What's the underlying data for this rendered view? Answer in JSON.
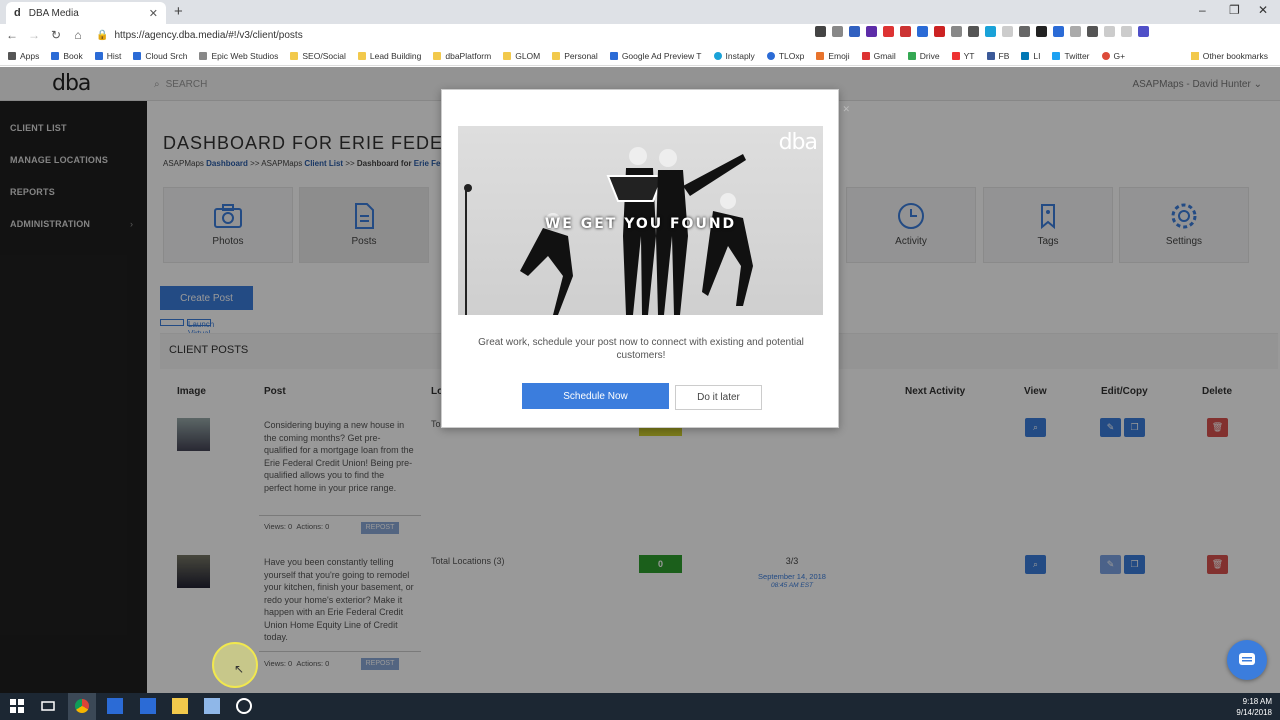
{
  "browser": {
    "tab_title": "DBA Media",
    "url": "https://agency.dba.media/#!/v3/client/posts",
    "bookmarks": [
      "Apps",
      "Book",
      "Hist",
      "Cloud Srch",
      "Epic Web Studios",
      "SEO/Social",
      "Lead Building",
      "dbaPlatform",
      "GLOM",
      "Personal",
      "Google Ad Preview T",
      "Instaply",
      "TLOxp",
      "Emoji",
      "Gmail",
      "Drive",
      "YT",
      "FB",
      "LI",
      "Twitter",
      "G+"
    ],
    "other_bookmarks": "Other bookmarks"
  },
  "header": {
    "logo": "dba",
    "search_placeholder": "SEARCH",
    "user": "ASAPMaps - David Hunter"
  },
  "sidebar": {
    "items": [
      {
        "label": "CLIENT LIST"
      },
      {
        "label": "MANAGE LOCATIONS"
      },
      {
        "label": "REPORTS"
      },
      {
        "label": "ADMINISTRATION"
      }
    ]
  },
  "main": {
    "title": "DASHBOARD FOR ERIE FEDERA",
    "breadcrumb": {
      "p1": "ASAPMaps ",
      "link1": "Dashboard",
      "p2": " >> ASAPMaps ",
      "link2": "Client List",
      "p3": " >> ",
      "p4": "Dashboard for ",
      "link3": "Erie Fe"
    },
    "tiles": [
      "Photos",
      "Posts",
      "Activity",
      "Tags",
      "Settings"
    ],
    "create_post": "Create Post",
    "virtual_tour": "Launch Virtual Tour",
    "section_title": "CLIENT POSTS",
    "columns": {
      "image": "Image",
      "post": "Post",
      "location": "Lo",
      "next_activity": "Next Activity",
      "view": "View",
      "edit_copy": "Edit/Copy",
      "delete": "Delete"
    },
    "posts": [
      {
        "text": "Considering buying a new house in the coming months? Get pre-qualified for a mortgage loan from the Erie Federal Credit Union! Being pre-qualified allows you to find the perfect home in your price range.",
        "location": "To",
        "views": "Views: 0",
        "actions": "Actions: 0",
        "repost": "REPOST"
      },
      {
        "text": "Have you been constantly telling yourself that you're going to remodel your kitchen, finish your basement, or redo your home's exterior? Make it happen with an Erie Federal Credit Union Home Equity Line of Credit today.",
        "location": "Total Locations (3)",
        "badge": "0",
        "progress": "3/3",
        "date": "September 14, 2018",
        "time": "08:45 AM EST",
        "views": "Views: 0",
        "actions": "Actions: 0",
        "repost": "REPOST"
      }
    ]
  },
  "modal": {
    "hero_logo": "dba",
    "hero_tagline": "WE GET YOU FOUND",
    "message": "Great work, schedule your post now to connect with existing and potential customers!",
    "schedule_label": "Schedule Now",
    "later_label": "Do it later"
  },
  "taskbar": {
    "time": "9:18 AM",
    "date": "9/14/2018"
  }
}
